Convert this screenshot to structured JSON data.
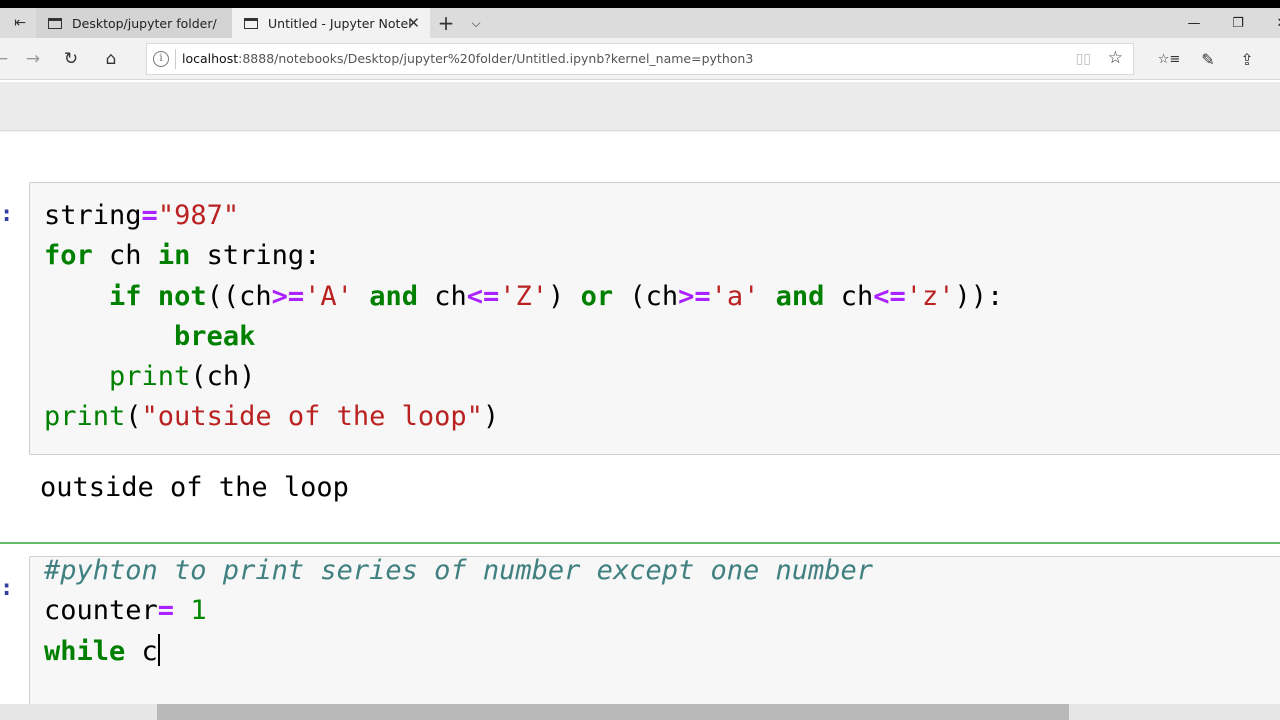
{
  "browser": {
    "tabs": [
      {
        "label": "Desktop/jupyter folder/",
        "active": false
      },
      {
        "label": "Untitled - Jupyter Notel",
        "active": true
      }
    ],
    "tab_actions": {
      "back_tabs_icon": "⇤",
      "new_tab": "+",
      "tab_list": "⌵",
      "close": "✕"
    },
    "window_controls": {
      "minimize": "—",
      "restore": "❐",
      "close": "✕"
    },
    "nav": {
      "back": "←",
      "forward": "→",
      "refresh": "↻",
      "home": "⌂"
    },
    "address": {
      "host": "localhost",
      "rest": ":8888/notebooks/Desktop/jupyter%20folder/Untitled.ipynb?kernel_name=python3",
      "info_icon": "i",
      "reading_view_icon": "▯▯",
      "favorite_icon": "☆"
    },
    "right_tools": {
      "favorites_hub": "☆≡",
      "notes": "✎",
      "share": "⇪"
    }
  },
  "notebook": {
    "cells": [
      {
        "prompt": ":",
        "lines": [
          [
            [
              "string",
              "plain"
            ],
            [
              "=",
              "op"
            ],
            [
              "\"987\"",
              "str"
            ]
          ],
          [
            [
              "for",
              "kw"
            ],
            [
              " ch ",
              "plain"
            ],
            [
              "in",
              "kw"
            ],
            [
              " string:",
              "plain"
            ]
          ],
          [
            [
              "    ",
              "plain"
            ],
            [
              "if",
              "kw"
            ],
            [
              " ",
              "plain"
            ],
            [
              "not",
              "kw"
            ],
            [
              "((ch",
              "plain"
            ],
            [
              ">=",
              "op"
            ],
            [
              "'A'",
              "str"
            ],
            [
              " ",
              "plain"
            ],
            [
              "and",
              "kw"
            ],
            [
              " ch",
              "plain"
            ],
            [
              "<=",
              "op"
            ],
            [
              "'Z'",
              "str"
            ],
            [
              ") ",
              "plain"
            ],
            [
              "or",
              "kw"
            ],
            [
              " (ch",
              "plain"
            ],
            [
              ">=",
              "op"
            ],
            [
              "'a'",
              "str"
            ],
            [
              " ",
              "plain"
            ],
            [
              "and",
              "kw"
            ],
            [
              " ch",
              "plain"
            ],
            [
              "<=",
              "op"
            ],
            [
              "'z'",
              "str"
            ],
            [
              ")):",
              "plain"
            ]
          ],
          [
            [
              "        ",
              "plain"
            ],
            [
              "break",
              "kw"
            ]
          ],
          [
            [
              "    ",
              "plain"
            ],
            [
              "print",
              "bi"
            ],
            [
              "(ch)",
              "plain"
            ]
          ],
          [
            [
              "print",
              "bi"
            ],
            [
              "(",
              "plain"
            ],
            [
              "\"outside of the loop\"",
              "str"
            ],
            [
              ")",
              "plain"
            ]
          ]
        ],
        "output": "outside of the loop"
      },
      {
        "prompt": ":",
        "lines": [
          [
            [
              "#pyhton to print series of number except one number",
              "cm"
            ]
          ],
          [
            [
              "counter",
              "plain"
            ],
            [
              "=",
              "op"
            ],
            [
              " ",
              "plain"
            ],
            [
              "1",
              "num"
            ]
          ],
          [
            [
              "while",
              "kw"
            ],
            [
              " c",
              "plain"
            ]
          ]
        ]
      }
    ]
  },
  "colors": {
    "keyword": "#008000",
    "string": "#ba2121",
    "operator": "#aa22ff",
    "comment": "#408080",
    "selected_cell_border": "#66bb6a",
    "prompt": "#303f9f"
  }
}
